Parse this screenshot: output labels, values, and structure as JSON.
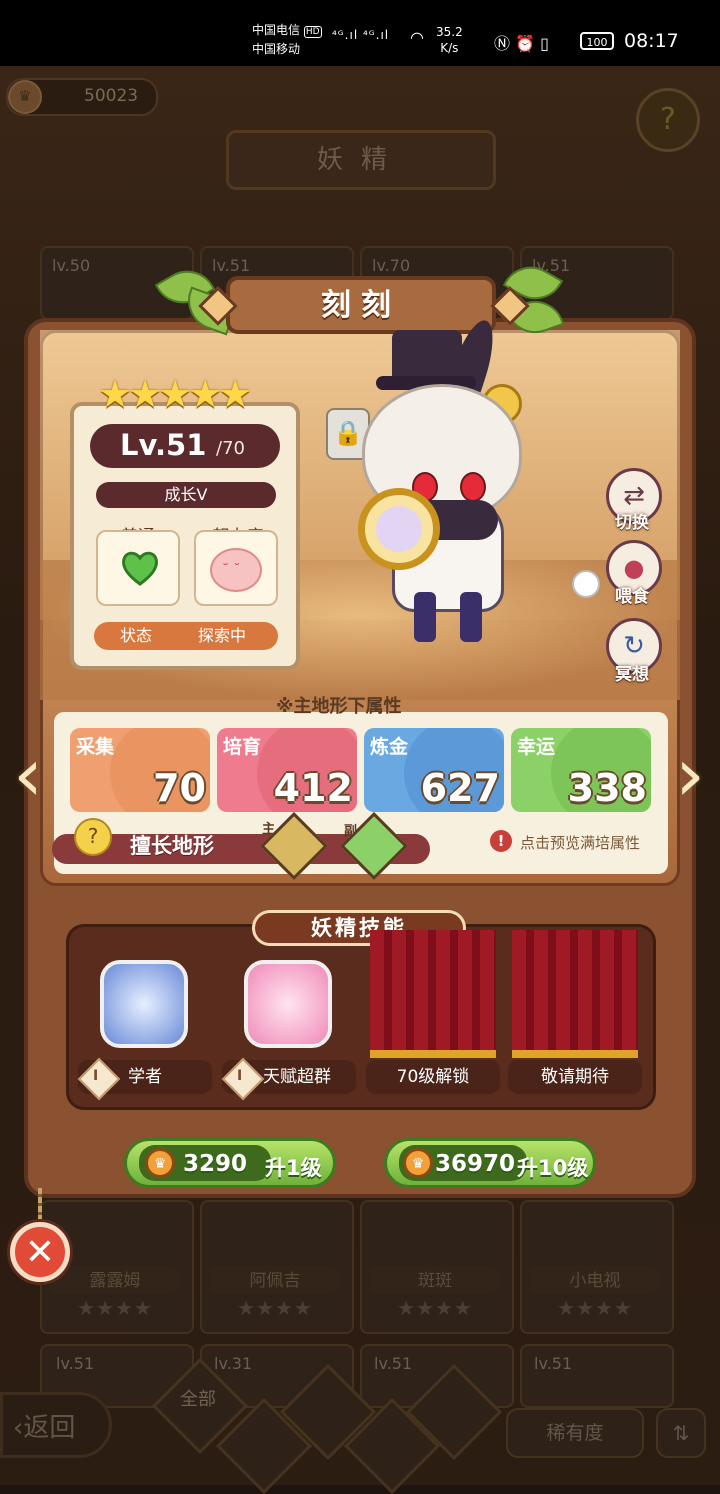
{
  "status_bar": {
    "carrier1": "中国电信",
    "carrier2": "中国移动",
    "hd": "HD",
    "signal": "⁴ᴳ.ıl ⁴ᴳ.ıl",
    "speed_value": "35.2",
    "speed_unit": "K/s",
    "battery": "100",
    "time": "08:17"
  },
  "top": {
    "coin_value": "50023",
    "page_title": "妖精",
    "help_icon": "question-leaf-icon"
  },
  "background_grid": {
    "top_levels": [
      "lv.50",
      "lv.51",
      "lv.70",
      "lv.51"
    ],
    "bottom_names": [
      "露露姆",
      "阿佩吉",
      "斑斑",
      "小电视"
    ],
    "lower_levels": [
      "lv.51",
      "lv.31",
      "lv.51",
      "lv.51"
    ],
    "card_stars": "★★★★"
  },
  "bottom_bar": {
    "back_label": "返回",
    "filter_all": "全部",
    "rarity_label": "稀有度",
    "sort_icon": "sort-icon"
  },
  "detail": {
    "name": "刻刻",
    "stars": 5,
    "star_text": "★★★★★",
    "level": "Lv.51",
    "level_max": "/70",
    "growth": "成长V",
    "mood_label": "普通",
    "effort_label": "努力度",
    "status_label": "状态",
    "status_value": "探索中",
    "side_actions": [
      {
        "label": "切换",
        "icon": "swap-icon"
      },
      {
        "label": "喂食",
        "icon": "meat-icon"
      },
      {
        "label": "冥想",
        "icon": "meditate-icon"
      }
    ],
    "attr_note": "※主地形下属性",
    "attributes": [
      {
        "name": "采集",
        "value": "70",
        "color": "#f0a070",
        "shade": "#e48a55"
      },
      {
        "name": "培育",
        "value": "412",
        "color": "#ee7c8e",
        "shade": "#e0606f"
      },
      {
        "name": "炼金",
        "value": "627",
        "color": "#6aa8e2",
        "shade": "#4e8cd0"
      },
      {
        "name": "幸运",
        "value": "338",
        "color": "#8cd068",
        "shade": "#72bc4c"
      }
    ],
    "terrain_label": "擅长地形",
    "terrain_main": "主",
    "terrain_sub": "副",
    "preview_hint": "点击预览满培属性"
  },
  "skills": {
    "title": "妖精技能",
    "slots": [
      {
        "label": "学者",
        "badge": "I",
        "icon": "snowman-scholar-icon"
      },
      {
        "label": "天赋超群",
        "badge": "I",
        "icon": "pink-octopus-icon"
      },
      {
        "label": "70级解锁",
        "icon": "curtain-locked-icon"
      },
      {
        "label": "敬请期待",
        "icon": "curtain-coming-icon"
      }
    ]
  },
  "upgrade": {
    "one_cost": "3290",
    "one_label": "升1级",
    "ten_cost": "36970",
    "ten_label": "升10级"
  },
  "colors": {
    "panel": "#8a5231",
    "upgrade_green": "#6fb13a",
    "close_red": "#e24a38"
  }
}
